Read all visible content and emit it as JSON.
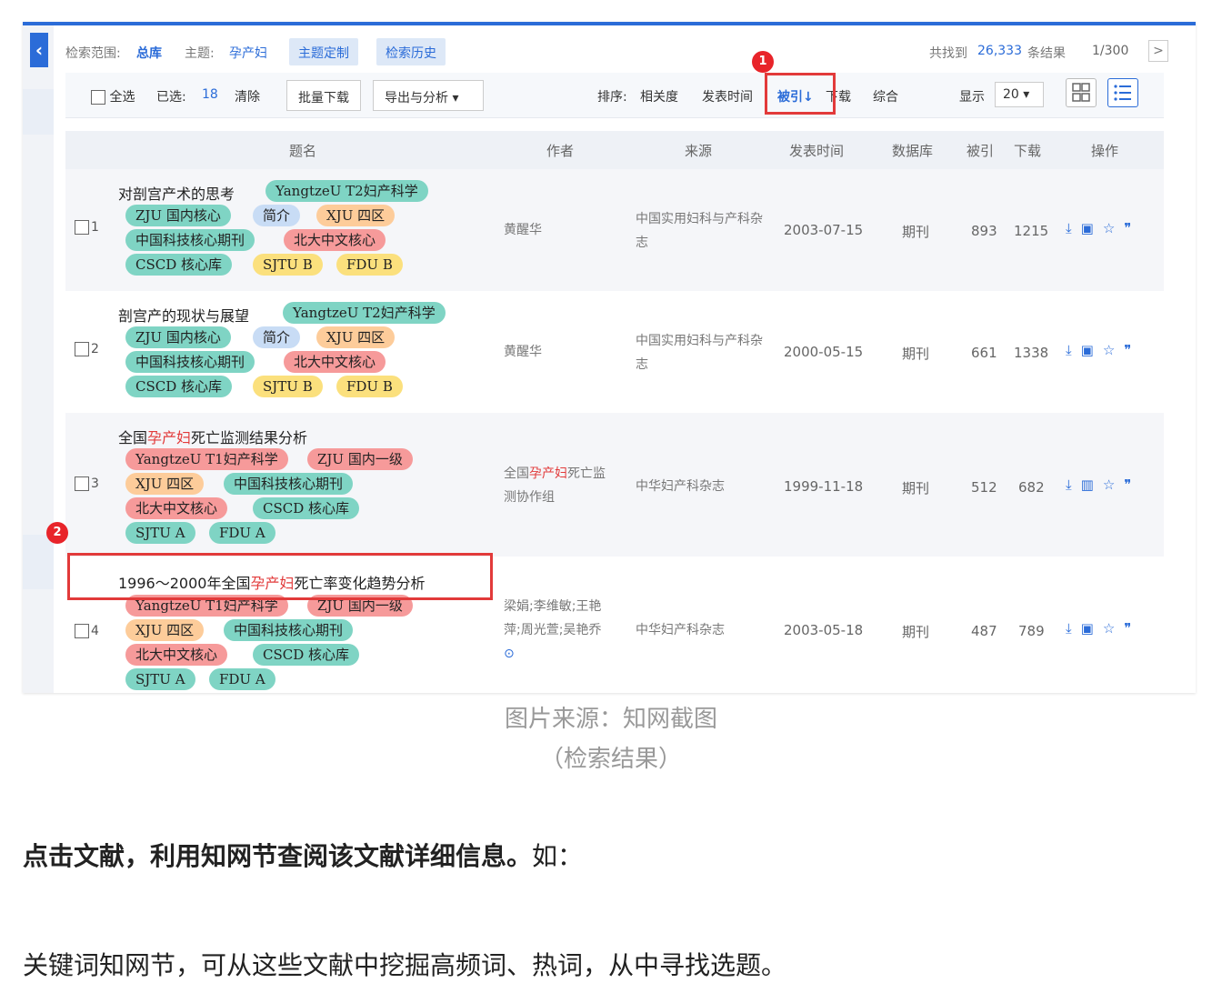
{
  "topbar": {
    "scope_label": "检索范围:",
    "scope_value": "总库",
    "topic_label": "主题:",
    "topic_value": "孕产妇",
    "btn_custom": "主题定制",
    "btn_history": "检索历史",
    "found_prefix": "共找到",
    "found_count": "26,333",
    "found_suffix": "条结果",
    "page": "1/300",
    "next": ">"
  },
  "toolbar": {
    "select_all": "全选",
    "selected_label": "已选:",
    "selected_count": "18",
    "clear": "清除",
    "batch_download": "批量下载",
    "export": "导出与分析 ▾",
    "sort_label": "排序:",
    "sort_relevance": "相关度",
    "sort_time": "发表时间",
    "sort_cited": "被引↓",
    "sort_download": "下载",
    "sort_overall": "综合",
    "display_label": "显示",
    "display_value": "20 ▾"
  },
  "table_header": {
    "title": "题名",
    "author": "作者",
    "source": "来源",
    "date": "发表时间",
    "db": "数据库",
    "cited": "被引",
    "download": "下载",
    "ops": "操作"
  },
  "rows": [
    {
      "num": "1",
      "title": "对剖宫产术的思考",
      "tags": [
        "YangtzeU T2妇产科学",
        "ZJU 国内核心",
        "简介",
        "XJU 四区",
        "中国科技核心期刊",
        "北大中文核心",
        "CSCD 核心库",
        "SJTU B",
        "FDU B"
      ],
      "author": "黄醒华",
      "source": "中国实用妇科与产科杂志",
      "date": "2003-07-15",
      "db": "期刊",
      "cited": "893",
      "download": "1215"
    },
    {
      "num": "2",
      "title": "剖宫产的现状与展望",
      "tags": [
        "YangtzeU T2妇产科学",
        "ZJU 国内核心",
        "简介",
        "XJU 四区",
        "中国科技核心期刊",
        "北大中文核心",
        "CSCD 核心库",
        "SJTU B",
        "FDU B"
      ],
      "author": "黄醒华",
      "source": "中国实用妇科与产科杂志",
      "date": "2000-05-15",
      "db": "期刊",
      "cited": "661",
      "download": "1338"
    },
    {
      "num": "3",
      "title_pre": "全国",
      "title_hl": "孕产妇",
      "title_post": "死亡监测结果分析",
      "tags": [
        "YangtzeU T1妇产科学",
        "ZJU 国内一级",
        "XJU 四区",
        "中国科技核心期刊",
        "北大中文核心",
        "CSCD 核心库",
        "SJTU A",
        "FDU A"
      ],
      "author_pre": "全国",
      "author_hl": "孕产妇",
      "author_post": "死亡监",
      "author_line2": "测协作组",
      "source": "中华妇产科杂志",
      "date": "1999-11-18",
      "db": "期刊",
      "cited": "512",
      "download": "682"
    },
    {
      "num": "4",
      "title_pre": "1996～2000年全国",
      "title_hl": "孕产妇",
      "title_post": "死亡率变化趋势分析",
      "tags": [
        "YangtzeU T1妇产科学",
        "ZJU 国内一级",
        "XJU 四区",
        "中国科技核心期刊",
        "北大中文核心",
        "CSCD 核心库",
        "SJTU A",
        "FDU A"
      ],
      "author_line1": "梁娟;李维敏;王艳",
      "author_line2": "萍;周光萱;吴艳乔",
      "source": "中华妇产科杂志",
      "date": "2003-05-18",
      "db": "期刊",
      "cited": "487",
      "download": "789"
    }
  ],
  "markers": {
    "m1": "1",
    "m2": "2"
  },
  "ops_icons": [
    "download-icon",
    "read-online-icon",
    "favorite-star-icon",
    "cite-icon"
  ],
  "caption": {
    "line1": "图片来源：知网截图",
    "line2": "（检索结果）"
  },
  "para1_bold": "点击文献，利用知网节查阅该文献详细信息。",
  "para1_rest": "如：",
  "para2": "关键词知网节，可从这些文献中挖掘高频词、热词，从中寻找选题。",
  "colors": {
    "accent": "#2b6cd8",
    "highlight": "#e23a3a"
  }
}
